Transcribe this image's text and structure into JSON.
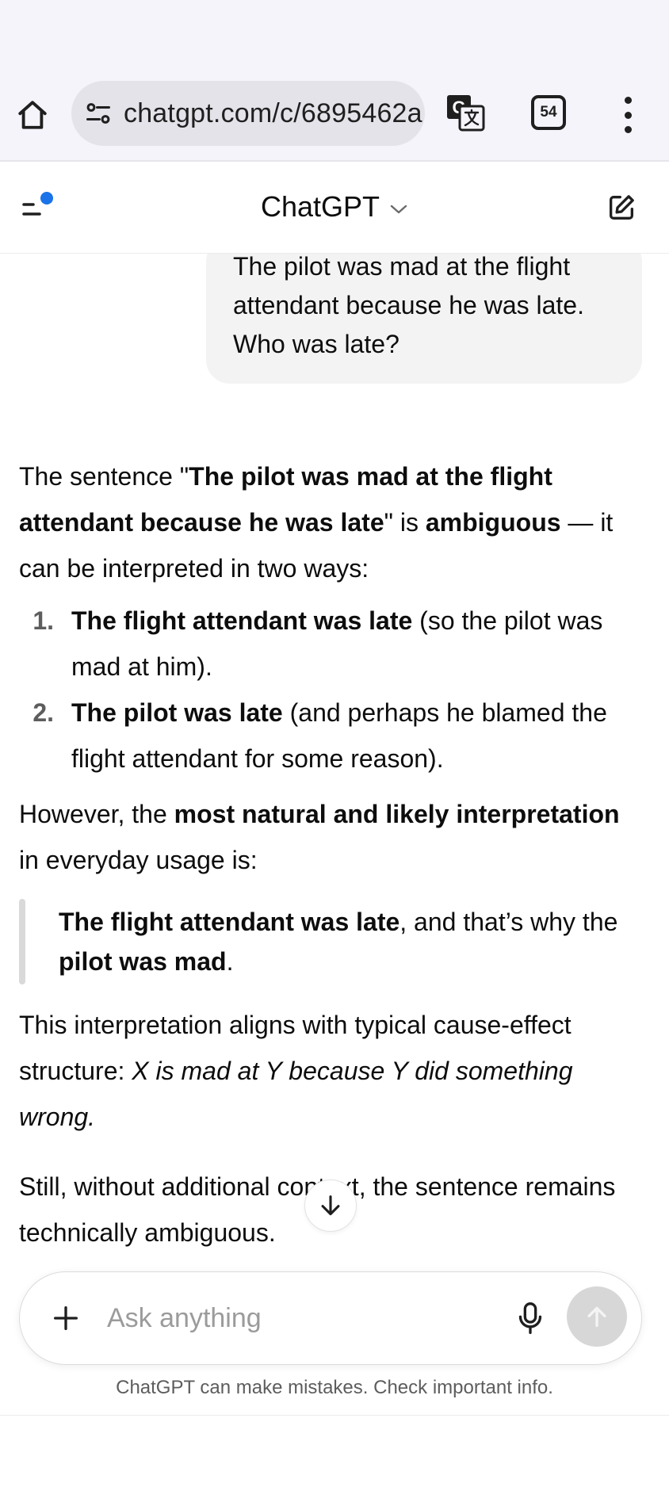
{
  "browser": {
    "url": "chatgpt.com/c/6895462a",
    "tab_count": "54"
  },
  "header": {
    "title": "ChatGPT"
  },
  "user_message": {
    "line1": "The pilot was mad at the flight",
    "line2": "attendant because he was late.",
    "line3": "Who was late?"
  },
  "assistant": {
    "p1": {
      "t1": "The sentence \"",
      "b1": "The pilot was mad at the flight attendant because he was late",
      "t2": "\" is ",
      "b2": "ambiguous",
      "t3": " — it can be interpreted in two ways:"
    },
    "list": [
      {
        "num": "1.",
        "bold": "The flight attendant was late",
        "rest": " (so the pilot was mad at him)."
      },
      {
        "num": "2.",
        "bold": "The pilot was late",
        "rest": " (and perhaps he blamed the flight attendant for some reason)."
      }
    ],
    "p2": {
      "t1": "However, the ",
      "b1": "most natural and likely interpretation",
      "t2": " in everyday usage is:"
    },
    "quote": {
      "b1": "The flight attendant was late",
      "t1": ", and that’s why the ",
      "b2": "pilot was mad",
      "t2": "."
    },
    "p3": {
      "t1": "This interpretation aligns with typical cause-effect structure: ",
      "i1": "X is mad at Y because Y did something wrong."
    },
    "p4": {
      "t1": "Still, without additional context, the sentence remains technically ambiguous."
    }
  },
  "composer": {
    "placeholder": "Ask anything"
  },
  "footer": {
    "disclaimer": "ChatGPT can make mistakes. Check important info."
  },
  "colors": {
    "chrome_bg": "#f5f4fb",
    "url_pill_bg": "#e4e3ea",
    "bubble_bg": "#f3f3f3",
    "notification_dot": "#1a73e8",
    "send_disabled": "#d7d7d7"
  },
  "icons": [
    "home-icon",
    "site-settings-icon",
    "translate-icon",
    "tabs-icon",
    "more-vert-icon",
    "sidebar-icon",
    "chevron-down-icon",
    "new-chat-icon",
    "arrow-down-icon",
    "plus-icon",
    "mic-icon",
    "arrow-up-icon"
  ]
}
